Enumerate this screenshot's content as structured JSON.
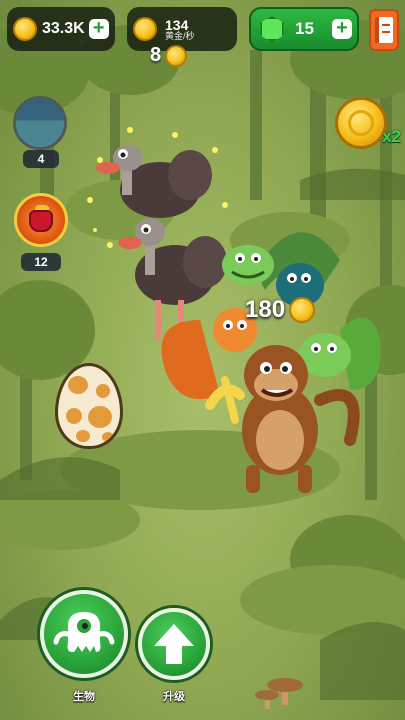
{
  "top_bar": {
    "gold": "33.3K",
    "gold_rate": "134",
    "gold_rate_unit": "黄金/秒",
    "gems": "15",
    "plus_symbol": "+"
  },
  "floating_rewards": {
    "top_counter": "8",
    "creature_income": "180"
  },
  "side": {
    "map_count": "4",
    "chest_count": "12",
    "bonus_multiplier": "x2"
  },
  "bottom_nav": {
    "creatures_label": "生物",
    "upgrade_label": "升级"
  },
  "icons": {
    "gold": "gold-coin-icon",
    "gem": "green-gem-icon",
    "menu": "quest-list-icon",
    "map": "world-map-icon",
    "chest": "red-gift-bag-icon",
    "creatures": "monster-icon",
    "upgrade": "up-arrow-icon"
  },
  "colors": {
    "forest_green": "#93ab55",
    "button_green": "#2aa43a",
    "gem_pill": "#2eb844",
    "menu_orange": "#f26a21",
    "coin_gold": "#f7c21e"
  }
}
